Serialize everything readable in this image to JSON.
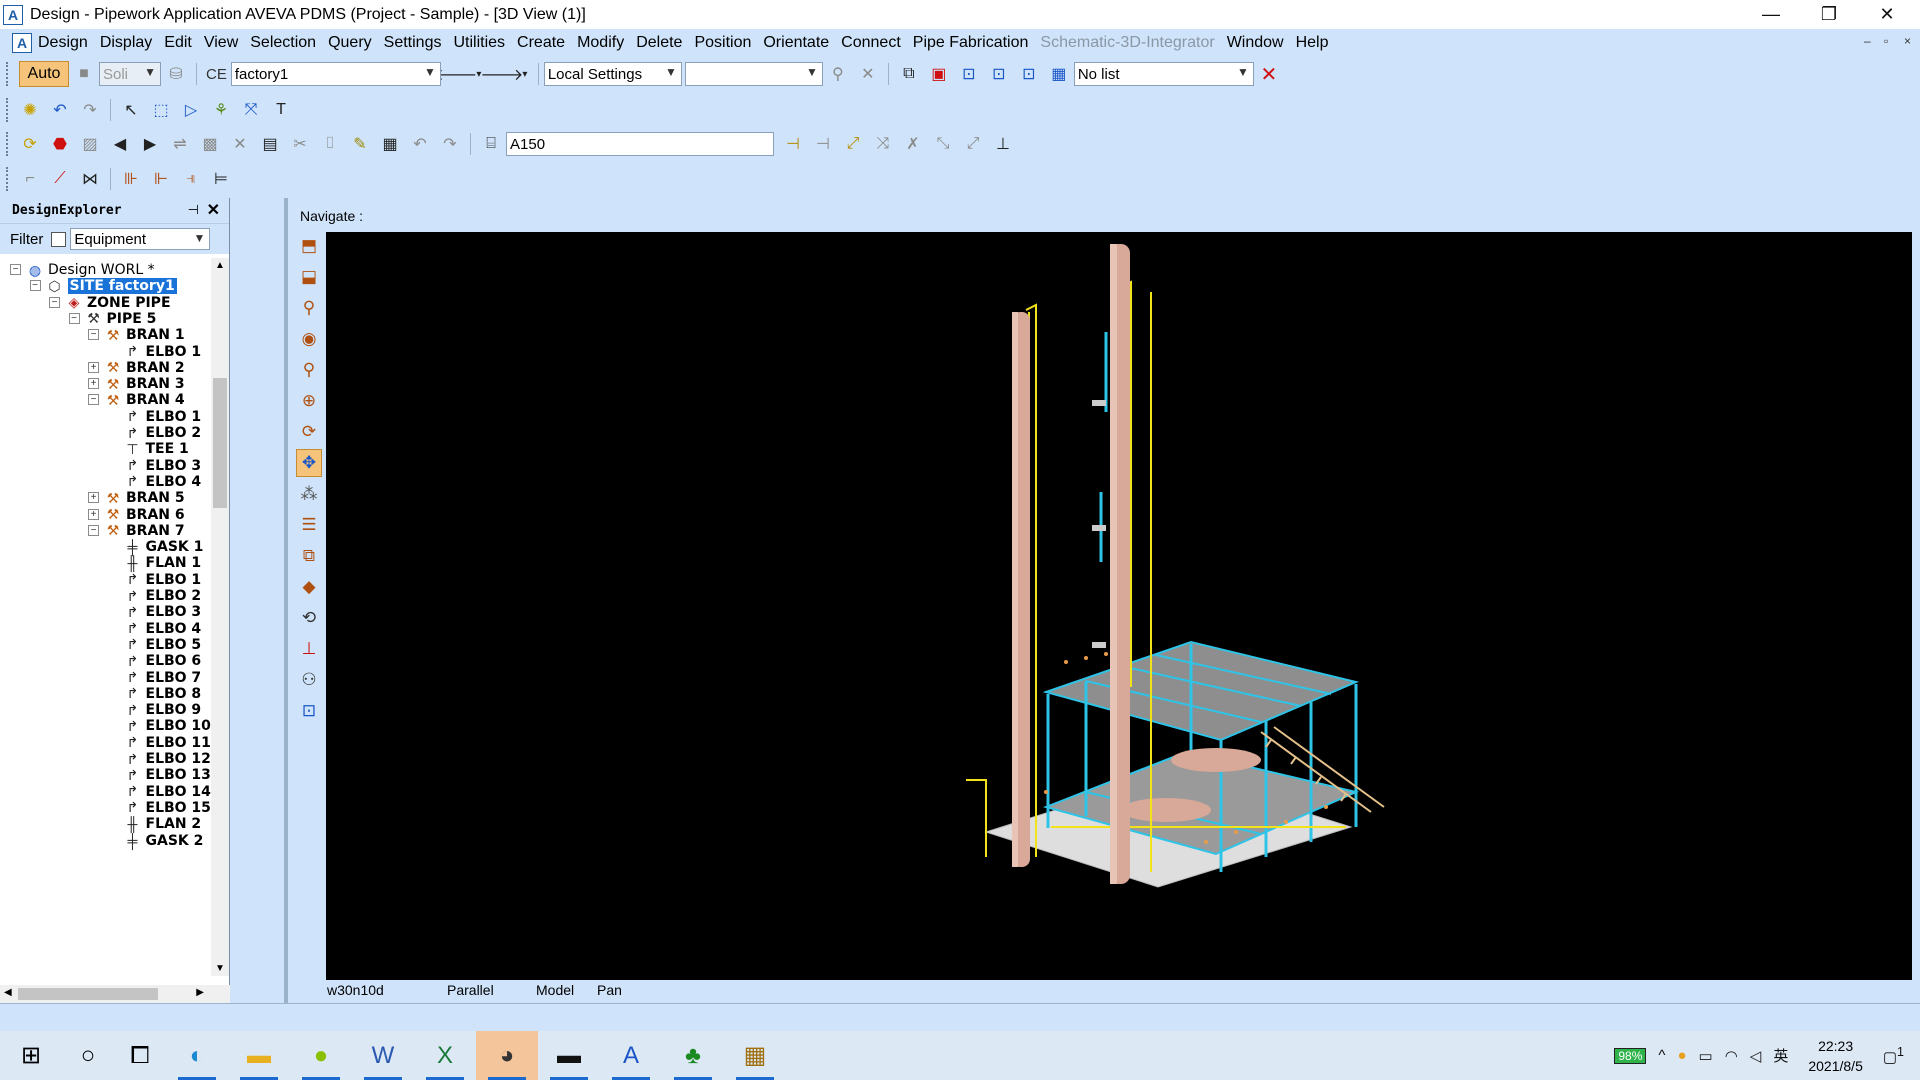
{
  "window": {
    "title": "Design - Pipework Application  AVEVA PDMS (Project - Sample) - [3D View (1)]",
    "logo_letter": "A",
    "min": "—",
    "restore": "❐",
    "close": "✕"
  },
  "menubar": {
    "items": [
      "Design",
      "Display",
      "Edit",
      "View",
      "Selection",
      "Query",
      "Settings",
      "Utilities",
      "Create",
      "Modify",
      "Delete",
      "Position",
      "Orientate",
      "Connect",
      "Pipe Fabrication"
    ],
    "disabled_item": "Schematic-3D-Integrator",
    "tail_items": [
      "Window",
      "Help"
    ],
    "mdi_min": "–",
    "mdi_restore": "▫",
    "mdi_close": "×"
  },
  "toolbar1": {
    "auto_label": "Auto",
    "solid_value": "Soli",
    "ce_label": "CE",
    "ce_value": "factory1",
    "settings_value": "Local Settings",
    "empty_combo": "",
    "list_value": "No list"
  },
  "toolbar3": {
    "spec_value": "A150"
  },
  "explorer": {
    "title": "DesignExplorer",
    "pin": "⊣",
    "close": "✕",
    "filter_label": "Filter",
    "filter_value": "Equipment",
    "tree": [
      {
        "label": "Design WORL *",
        "level": 0,
        "expander": "−",
        "icon": "globe",
        "bold": false
      },
      {
        "label": "SITE factory1",
        "level": 1,
        "expander": "−",
        "icon": "site",
        "bold": true,
        "selected": true
      },
      {
        "label": "ZONE PIPE",
        "level": 2,
        "expander": "−",
        "icon": "zone",
        "bold": true
      },
      {
        "label": "PIPE 5",
        "level": 3,
        "expander": "−",
        "icon": "pipe",
        "bold": true
      },
      {
        "label": "BRAN 1",
        "level": 4,
        "expander": "−",
        "icon": "bran",
        "bold": true
      },
      {
        "label": "ELBO 1",
        "level": 5,
        "expander": "",
        "icon": "elbo",
        "bold": true
      },
      {
        "label": "BRAN 2",
        "level": 4,
        "expander": "+",
        "icon": "bran",
        "bold": true
      },
      {
        "label": "BRAN 3",
        "level": 4,
        "expander": "+",
        "icon": "bran",
        "bold": true
      },
      {
        "label": "BRAN 4",
        "level": 4,
        "expander": "−",
        "icon": "bran",
        "bold": true
      },
      {
        "label": "ELBO 1",
        "level": 5,
        "expander": "",
        "icon": "elbo",
        "bold": true
      },
      {
        "label": "ELBO 2",
        "level": 5,
        "expander": "",
        "icon": "elbo",
        "bold": true
      },
      {
        "label": "TEE 1",
        "level": 5,
        "expander": "",
        "icon": "tee",
        "bold": true
      },
      {
        "label": "ELBO 3",
        "level": 5,
        "expander": "",
        "icon": "elbo",
        "bold": true
      },
      {
        "label": "ELBO 4",
        "level": 5,
        "expander": "",
        "icon": "elbo",
        "bold": true
      },
      {
        "label": "BRAN 5",
        "level": 4,
        "expander": "+",
        "icon": "bran",
        "bold": true
      },
      {
        "label": "BRAN 6",
        "level": 4,
        "expander": "+",
        "icon": "bran",
        "bold": true
      },
      {
        "label": "BRAN 7",
        "level": 4,
        "expander": "−",
        "icon": "bran",
        "bold": true
      },
      {
        "label": "GASK 1",
        "level": 5,
        "expander": "",
        "icon": "gask",
        "bold": true
      },
      {
        "label": "FLAN 1",
        "level": 5,
        "expander": "",
        "icon": "flan",
        "bold": true
      },
      {
        "label": "ELBO 1",
        "level": 5,
        "expander": "",
        "icon": "elbo",
        "bold": true
      },
      {
        "label": "ELBO 2",
        "level": 5,
        "expander": "",
        "icon": "elbo",
        "bold": true
      },
      {
        "label": "ELBO 3",
        "level": 5,
        "expander": "",
        "icon": "elbo",
        "bold": true
      },
      {
        "label": "ELBO 4",
        "level": 5,
        "expander": "",
        "icon": "elbo",
        "bold": true
      },
      {
        "label": "ELBO 5",
        "level": 5,
        "expander": "",
        "icon": "elbo",
        "bold": true
      },
      {
        "label": "ELBO 6",
        "level": 5,
        "expander": "",
        "icon": "elbo",
        "bold": true
      },
      {
        "label": "ELBO 7",
        "level": 5,
        "expander": "",
        "icon": "elbo",
        "bold": true
      },
      {
        "label": "ELBO 8",
        "level": 5,
        "expander": "",
        "icon": "elbo",
        "bold": true
      },
      {
        "label": "ELBO 9",
        "level": 5,
        "expander": "",
        "icon": "elbo",
        "bold": true
      },
      {
        "label": "ELBO 10",
        "level": 5,
        "expander": "",
        "icon": "elbo",
        "bold": true
      },
      {
        "label": "ELBO 11",
        "level": 5,
        "expander": "",
        "icon": "elbo",
        "bold": true
      },
      {
        "label": "ELBO 12",
        "level": 5,
        "expander": "",
        "icon": "elbo",
        "bold": true
      },
      {
        "label": "ELBO 13",
        "level": 5,
        "expander": "",
        "icon": "elbo",
        "bold": true
      },
      {
        "label": "ELBO 14",
        "level": 5,
        "expander": "",
        "icon": "elbo",
        "bold": true
      },
      {
        "label": "ELBO 15",
        "level": 5,
        "expander": "",
        "icon": "elbo",
        "bold": true
      },
      {
        "label": "FLAN 2",
        "level": 5,
        "expander": "",
        "icon": "flan",
        "bold": true
      },
      {
        "label": "GASK 2",
        "level": 5,
        "expander": "",
        "icon": "gask",
        "bold": true
      }
    ]
  },
  "view3d": {
    "navigate_label": "Navigate :",
    "status": {
      "direction": "w30n10d",
      "projection": "Parallel",
      "mode": "Model",
      "action": "Pan"
    }
  },
  "taskbar": {
    "battery": "98%",
    "ime": "英",
    "time": "22:23",
    "date": "2021/8/5",
    "notification_count": "1"
  },
  "colors": {
    "ui_blue": "#cfe4fa",
    "selection": "#1a73d9",
    "auto_button": "#f5c47a",
    "viewport": "#000000",
    "steel": "#2ec4e8",
    "pipe_yellow": "#f2e21a",
    "column": "#d8a898"
  }
}
